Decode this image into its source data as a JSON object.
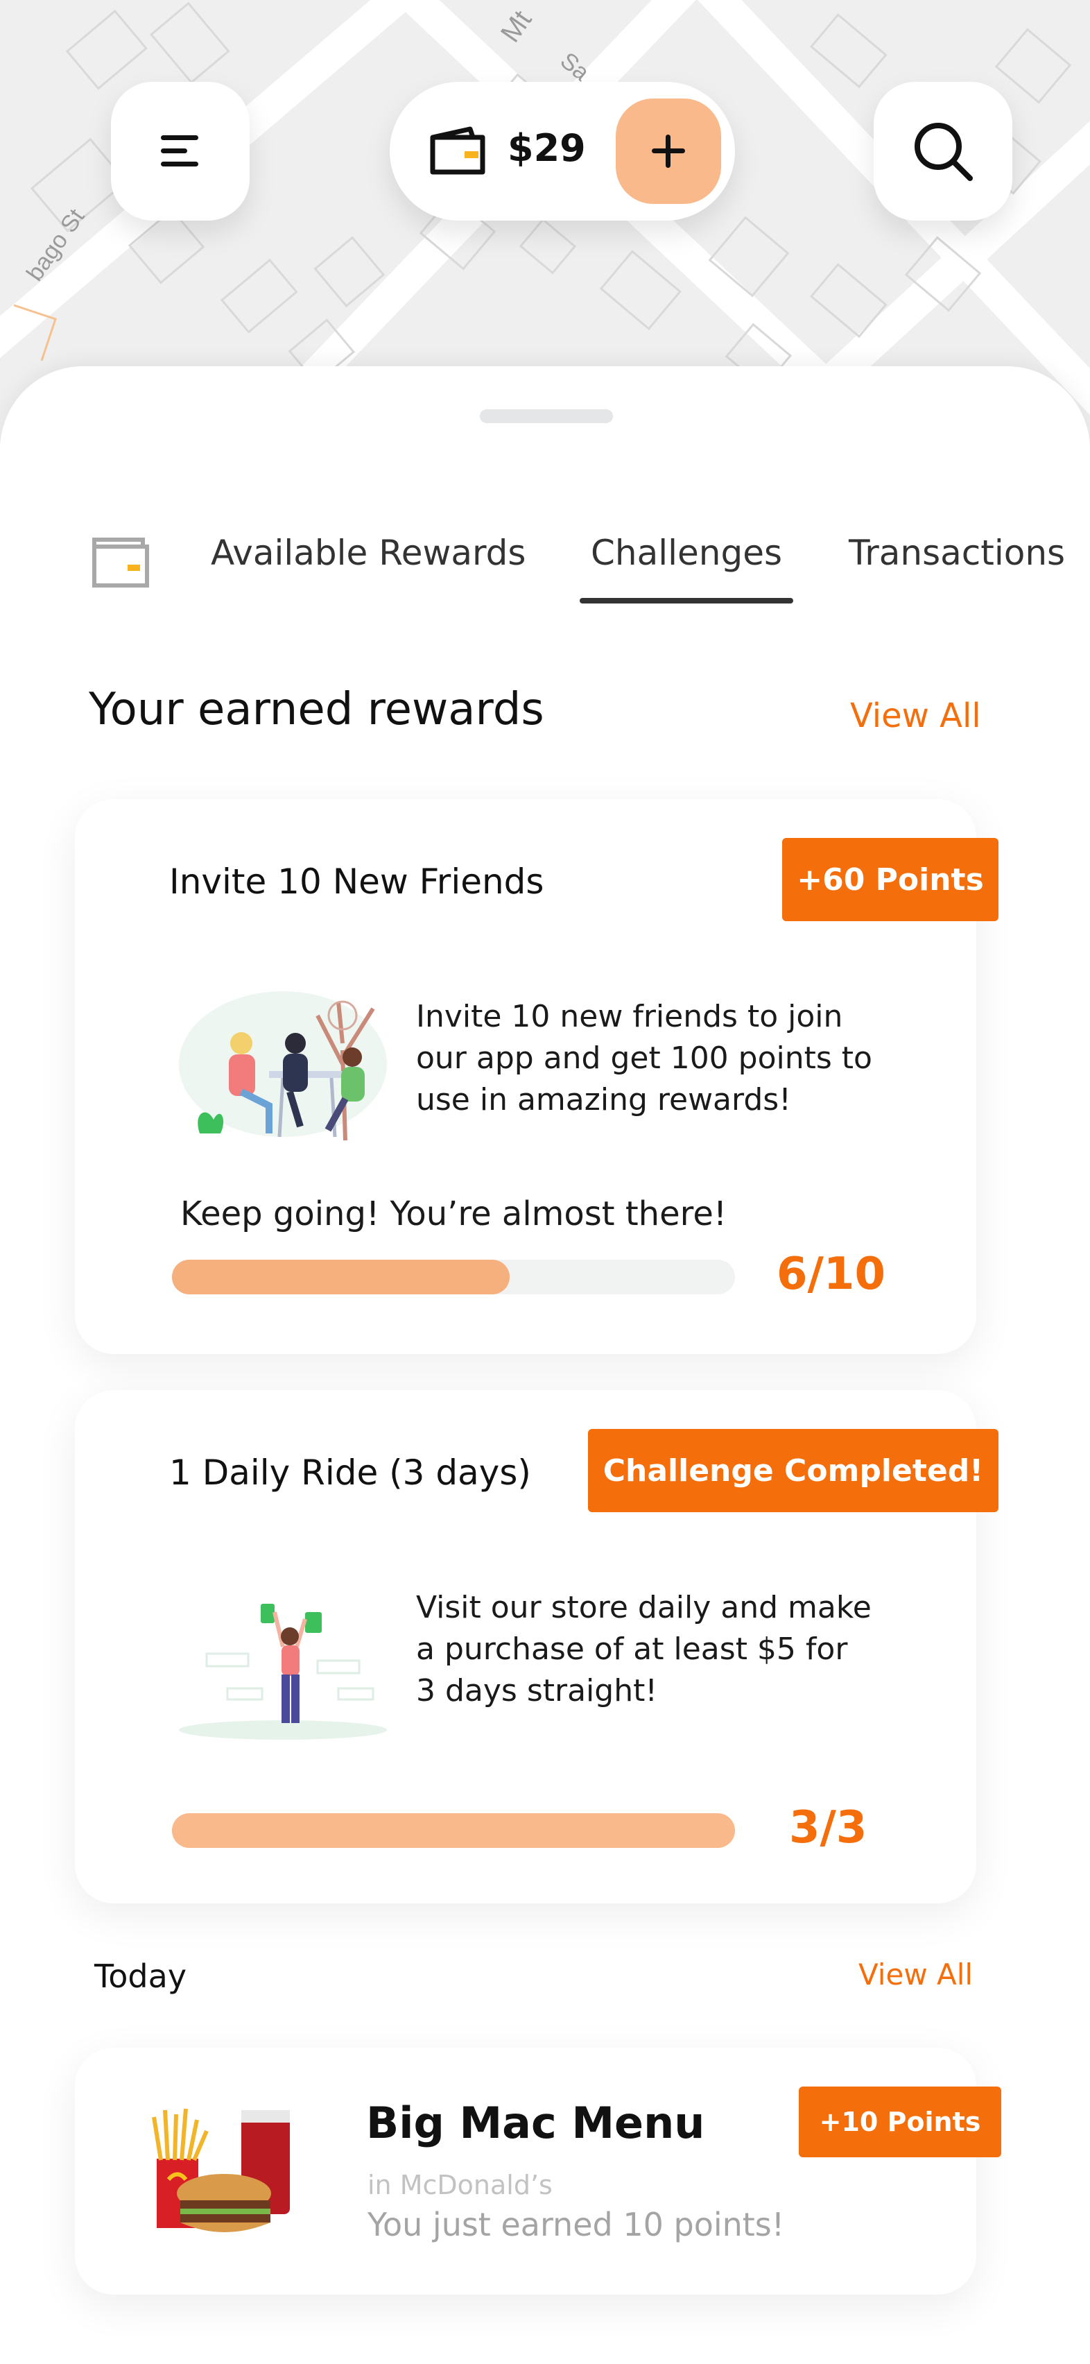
{
  "map": {
    "street_labels": [
      "bago St",
      "Mt",
      "Sa"
    ]
  },
  "topbar": {
    "menu_icon": "hamburger-icon",
    "wallet_icon": "wallet-icon",
    "balance": "$29",
    "add_icon": "plus-icon",
    "search_icon": "search-icon"
  },
  "tabs": {
    "icon": "wallet-icon",
    "items": [
      {
        "label": "Available Rewards",
        "active": false
      },
      {
        "label": "Challenges",
        "active": true
      },
      {
        "label": "Transactions",
        "active": false
      }
    ]
  },
  "earned": {
    "title": "Your earned rewards",
    "view_all": "View All",
    "cards": [
      {
        "title": "Invite 10 New Friends",
        "badge": "+60 Points",
        "illustration": "friends-at-table-illustration",
        "description": "Invite 10 new friends to join our app and get 100 points to use in amazing rewards!",
        "status": "Keep going! You’re almost there!",
        "progress_text": "6/10",
        "progress": 0.6
      },
      {
        "title": "1 Daily Ride (3 days)",
        "badge": "Challenge Completed!",
        "illustration": "shopping-woman-illustration",
        "description": "Visit our store daily and make a purchase of at least $5 for 3 days straight!",
        "status": "",
        "progress_text": "3/3",
        "progress": 1.0
      }
    ]
  },
  "today": {
    "title": "Today",
    "view_all": "View All",
    "items": [
      {
        "image": "big-mac-meal-image",
        "name": "Big Mac Menu",
        "place": "in McDonald’s",
        "message": "You just earned 10 points!",
        "badge": "+10 Points"
      }
    ]
  },
  "colors": {
    "accent": "#f46e0c",
    "accent_light": "#f9b98a",
    "progress_fill": "#f5b07e",
    "progress_track": "#f1f2f2"
  }
}
